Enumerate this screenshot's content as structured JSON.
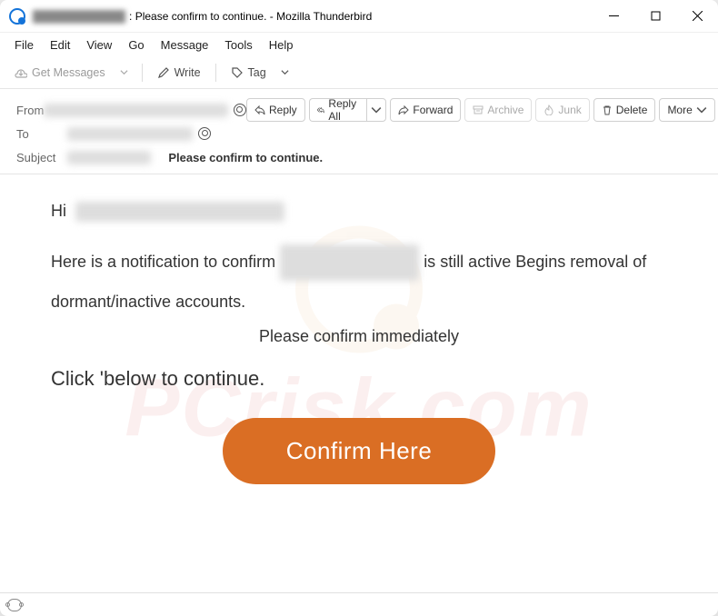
{
  "window": {
    "title_redacted": "████████████",
    "title_suffix": ": Please confirm to continue. - Mozilla Thunderbird"
  },
  "menubar": [
    "File",
    "Edit",
    "View",
    "Go",
    "Message",
    "Tools",
    "Help"
  ],
  "toolbar": {
    "get_messages": "Get Messages",
    "write": "Write",
    "tag": "Tag"
  },
  "header": {
    "from_label": "From",
    "from_value_redacted": "██████████████████████",
    "to_label": "To",
    "to_value_redacted": "███████████████",
    "subject_label": "Subject",
    "subject_redacted": "██████████",
    "subject_bold": "Please confirm to continue."
  },
  "actions": {
    "reply": "Reply",
    "reply_all": "Reply All",
    "forward": "Forward",
    "archive": "Archive",
    "junk": "Junk",
    "delete": "Delete",
    "more": "More"
  },
  "body": {
    "hi": "Hi",
    "hi_redacted": "██████████████████",
    "line1a": "Here is a notification to confirm",
    "line1_redacted": "████████████",
    "line1b": "is still active Begins removal of",
    "line2": "dormant/inactive accounts.",
    "center": "Please confirm immediately",
    "click": "Click 'below to continue.",
    "cta": "Confirm Here"
  },
  "watermark": {
    "text": "PCrisk.com"
  },
  "colors": {
    "cta": "#da6e24"
  }
}
